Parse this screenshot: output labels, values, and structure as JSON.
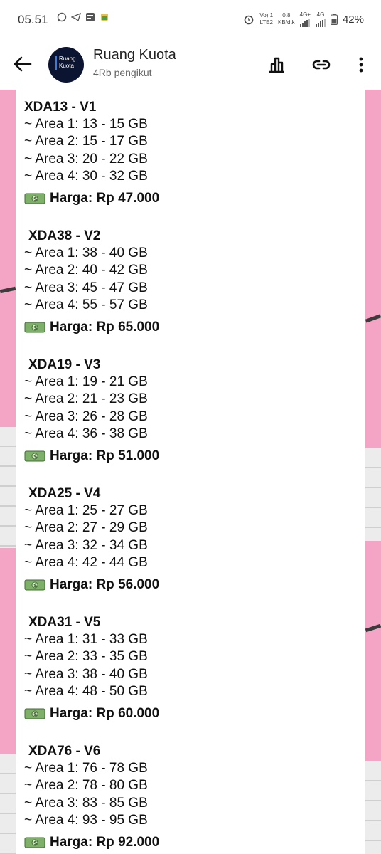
{
  "status": {
    "time": "05.51",
    "net_top": "Vo) 1",
    "net_bottom": "LTE2",
    "speed_top": "0.8",
    "speed_bottom": "KB/dtk",
    "sig1": "4G+",
    "sig2": "4G",
    "battery": "42%"
  },
  "header": {
    "channel_name": "Ruang Kuota",
    "followers": "4Rb pengikut",
    "avatar_line1": "Ruang",
    "avatar_line2": "Kuota"
  },
  "packages": [
    {
      "title": "XDA13 - V1",
      "areas": [
        "~ Area 1: 13 - 15 GB",
        "~ Area 2: 15 - 17 GB",
        "~ Area 3: 20 - 22 GB",
        "~ Area 4: 30 - 32 GB"
      ],
      "price": "Harga: Rp 47.000"
    },
    {
      "title": "XDA38 - V2",
      "areas": [
        "~ Area 1: 38 - 40 GB",
        "~ Area 2: 40 - 42 GB",
        "~ Area 3: 45 - 47 GB",
        "~ Area 4: 55 - 57 GB"
      ],
      "price": "Harga: Rp 65.000"
    },
    {
      "title": "XDA19 - V3",
      "areas": [
        "~ Area 1: 19 - 21 GB",
        "~ Area 2: 21 - 23 GB",
        "~ Area 3: 26 - 28 GB",
        "~ Area 4: 36 - 38 GB"
      ],
      "price": "Harga: Rp 51.000"
    },
    {
      "title": "XDA25 - V4",
      "areas": [
        "~ Area 1: 25 - 27 GB",
        "~ Area 2: 27 - 29 GB",
        "~ Area 3: 32 - 34 GB",
        "~ Area 4: 42 - 44 GB"
      ],
      "price": "Harga: Rp 56.000"
    },
    {
      "title": "XDA31 - V5",
      "areas": [
        "~ Area 1: 31 - 33 GB",
        "~ Area 2: 33 - 35 GB",
        "~ Area 3: 38 - 40 GB",
        "~ Area 4: 48 - 50 GB"
      ],
      "price": "Harga: Rp 60.000"
    },
    {
      "title": "XDA76 - V6",
      "areas": [
        "~ Area 1: 76 - 78 GB",
        "~ Area 2: 78 - 80 GB",
        "~ Area 3: 83 - 85 GB",
        "~ Area 4: 93 - 95 GB"
      ],
      "price": "Harga: Rp 92.000"
    }
  ],
  "icons": {
    "back": "arrow-left-icon",
    "stats": "bar-chart-icon",
    "link": "link-icon",
    "menu": "more-vertical-icon",
    "money": "banknote-icon"
  },
  "colors": {
    "background_pink": "#f4a4c4",
    "text": "#111111",
    "header_bg": "#ffffff"
  }
}
